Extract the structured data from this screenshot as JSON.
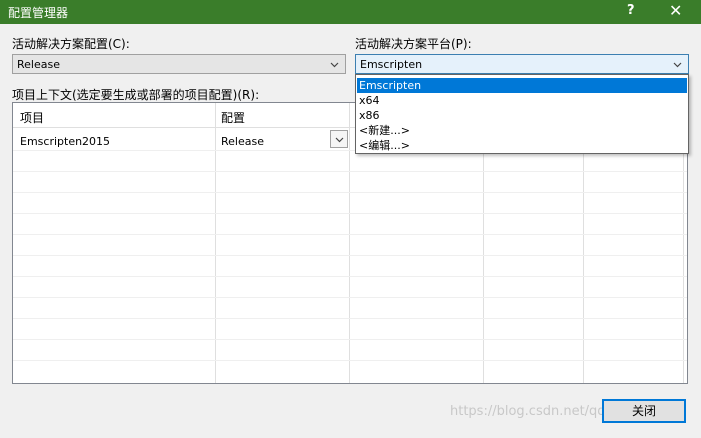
{
  "window": {
    "title": "配置管理器",
    "help": "?",
    "close": "✕"
  },
  "solution_config": {
    "label": "活动解决方案配置(C):",
    "value": "Release"
  },
  "solution_platform": {
    "label": "活动解决方案平台(P):",
    "value": "Emscripten",
    "options": [
      "Emscripten",
      "x64",
      "x86",
      "<新建...>",
      "<编辑...>"
    ]
  },
  "project_context": {
    "label": "项目上下文(选定要生成或部署的项目配置)(R):",
    "columns": [
      "项目",
      "配置"
    ],
    "rows": [
      {
        "project": "Emscripten2015",
        "config": "Release"
      }
    ]
  },
  "buttons": {
    "close": "关闭"
  },
  "watermark": "https://blog.csdn.net/qq_15001181"
}
